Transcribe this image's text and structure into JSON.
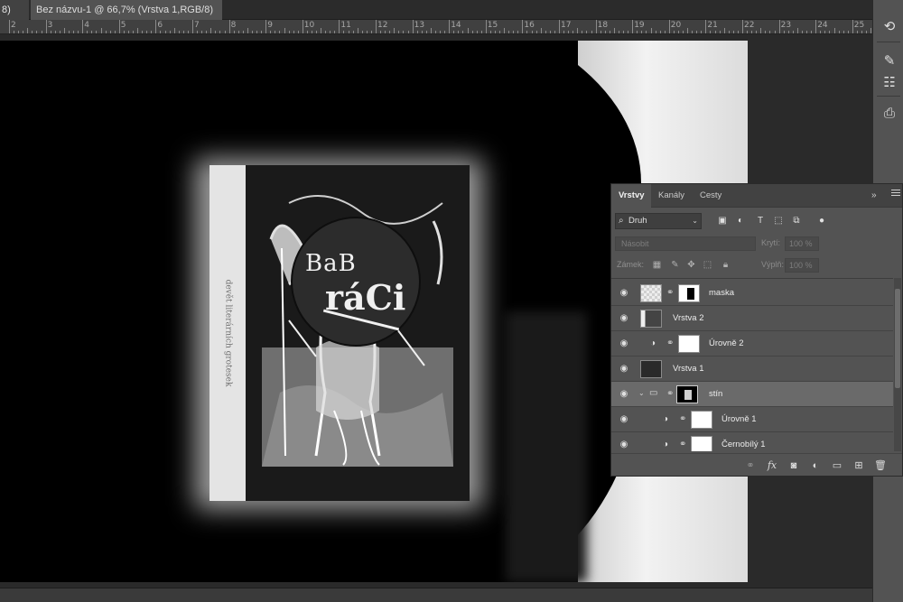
{
  "tabs": [
    {
      "label": "8) *",
      "close": "×"
    },
    {
      "label": "Bez názvu-1 @ 66,7% (Vrstva 1,RGB/8) *",
      "close": "×"
    }
  ],
  "ruler": {
    "labels": [
      "2",
      "3",
      "4",
      "5",
      "6",
      "7",
      "8",
      "9",
      "10",
      "11",
      "12",
      "13",
      "14",
      "15",
      "16",
      "17",
      "18",
      "19",
      "20",
      "21",
      "22",
      "23",
      "24",
      "25"
    ]
  },
  "book": {
    "spine_text": "devět literárních grotesek",
    "badge_line1": "BaB",
    "badge_line2": "ráCi"
  },
  "right_dock": {
    "icons": [
      "history-icon",
      "brush-presets-icon",
      "adjust-presets-icon",
      "clone-source-icon"
    ]
  },
  "layers_panel": {
    "tabs": [
      {
        "label": "Vrstvy",
        "active": true
      },
      {
        "label": "Kanály",
        "active": false
      },
      {
        "label": "Cesty",
        "active": false
      }
    ],
    "expand_label": "»",
    "filter": {
      "kind_label": "Druh",
      "search_glyph": "⌕",
      "caret": "⌄"
    },
    "filter_icons": [
      "image-filter-icon",
      "adjustment-filter-icon",
      "type-filter-icon",
      "shape-filter-icon",
      "smart-object-filter-icon",
      "filter-toggle-icon"
    ],
    "blend_mode": "Násobit",
    "opacity_label": "Krytí:",
    "opacity_value": "100 %",
    "lock_label": "Zámek:",
    "fill_label": "Výplň:",
    "fill_value": "100 %",
    "layers": [
      {
        "name": "maska",
        "type": "pixel-masked",
        "visible": true,
        "selected": false
      },
      {
        "name": "Vrstva 2",
        "type": "pixel",
        "visible": true,
        "selected": false
      },
      {
        "name": "Úrovně 2",
        "type": "adjustment",
        "visible": true,
        "selected": false
      },
      {
        "name": "Vrstva 1",
        "type": "pixel",
        "visible": true,
        "selected": false
      },
      {
        "name": "stín",
        "type": "group",
        "visible": true,
        "selected": true
      },
      {
        "name": "Úrovně 1",
        "type": "adjustment-child",
        "visible": true,
        "selected": false
      },
      {
        "name": "Černobílý 1",
        "type": "adjustment-child",
        "visible": true,
        "selected": false
      }
    ],
    "footer_icons": [
      "link-layers-icon",
      "fx-icon",
      "add-mask-icon",
      "new-adjustment-icon",
      "new-group-icon",
      "new-layer-icon",
      "delete-layer-icon"
    ],
    "footer_fx": "fx"
  },
  "colors": {
    "panel_bg": "#535353",
    "selected_row": "#6a6a6a",
    "app_bg": "#282828"
  }
}
